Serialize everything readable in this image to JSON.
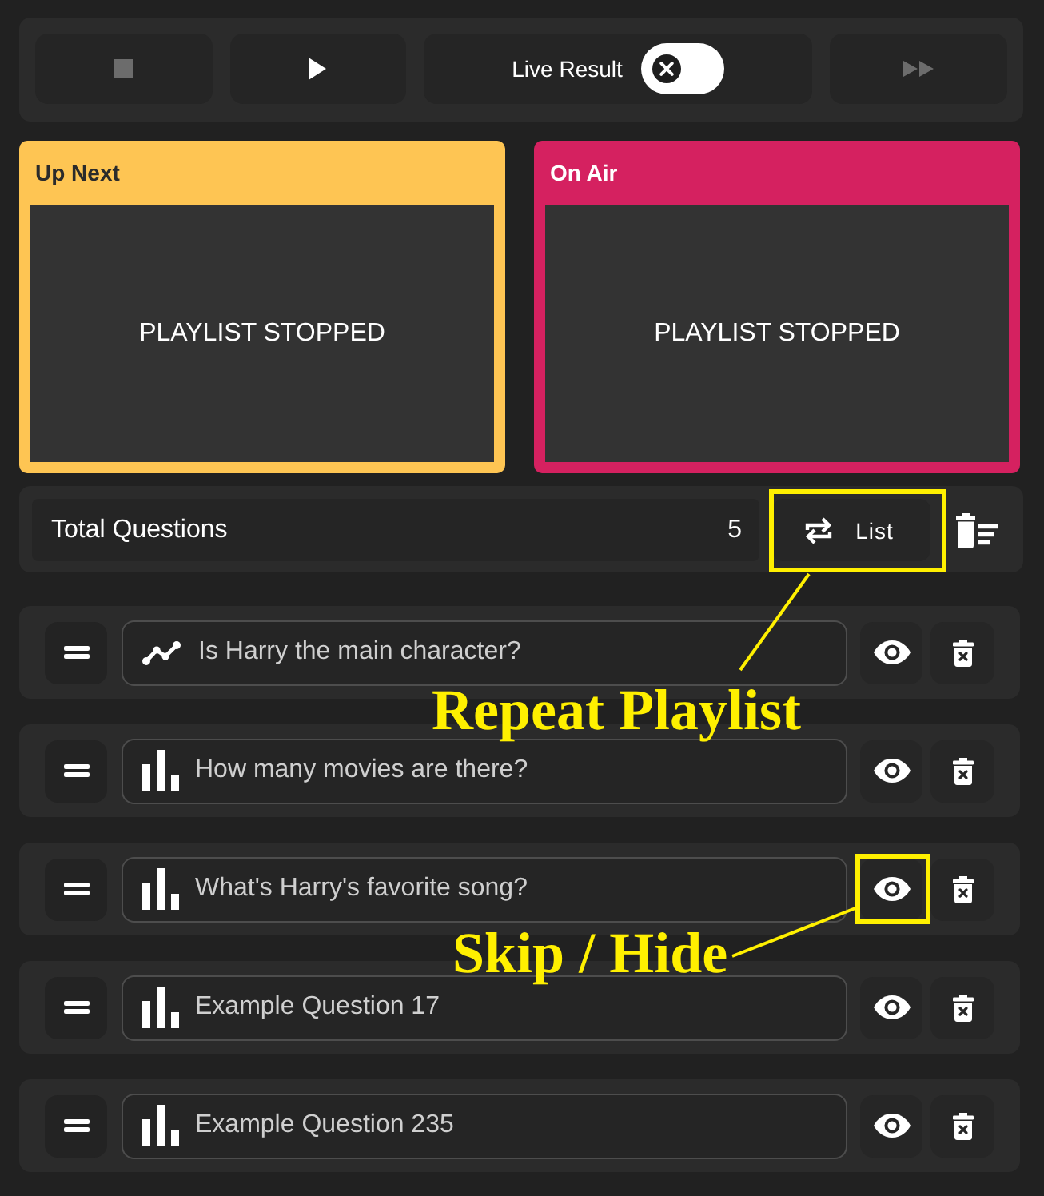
{
  "toolbar": [
    {
      "kind": "stop",
      "disabled": true
    },
    {
      "kind": "play",
      "disabled": false
    },
    {
      "kind": "toggle",
      "label": "Live Result",
      "on": false
    },
    {
      "kind": "skip",
      "disabled": true
    }
  ],
  "monitors": [
    {
      "title": "Up Next",
      "status": "PLAYLIST STOPPED",
      "color": "#fec553"
    },
    {
      "title": "On Air",
      "status": "PLAYLIST STOPPED",
      "color": "#d52160"
    }
  ],
  "summary": {
    "label": "Total Questions",
    "count": "5",
    "repeat_button": {
      "label": "List",
      "callout": "Repeat Playlist"
    }
  },
  "questions": [
    {
      "kind": "line",
      "text": "Is Harry the main character?"
    },
    {
      "kind": "bar",
      "text": "How many movies are there?"
    },
    {
      "kind": "bar",
      "text": "What's Harry's favorite song?",
      "callout": "Skip / Hide"
    },
    {
      "kind": "bar",
      "text": "Example Question 17"
    },
    {
      "kind": "bar",
      "text": "Example Question 235"
    }
  ]
}
